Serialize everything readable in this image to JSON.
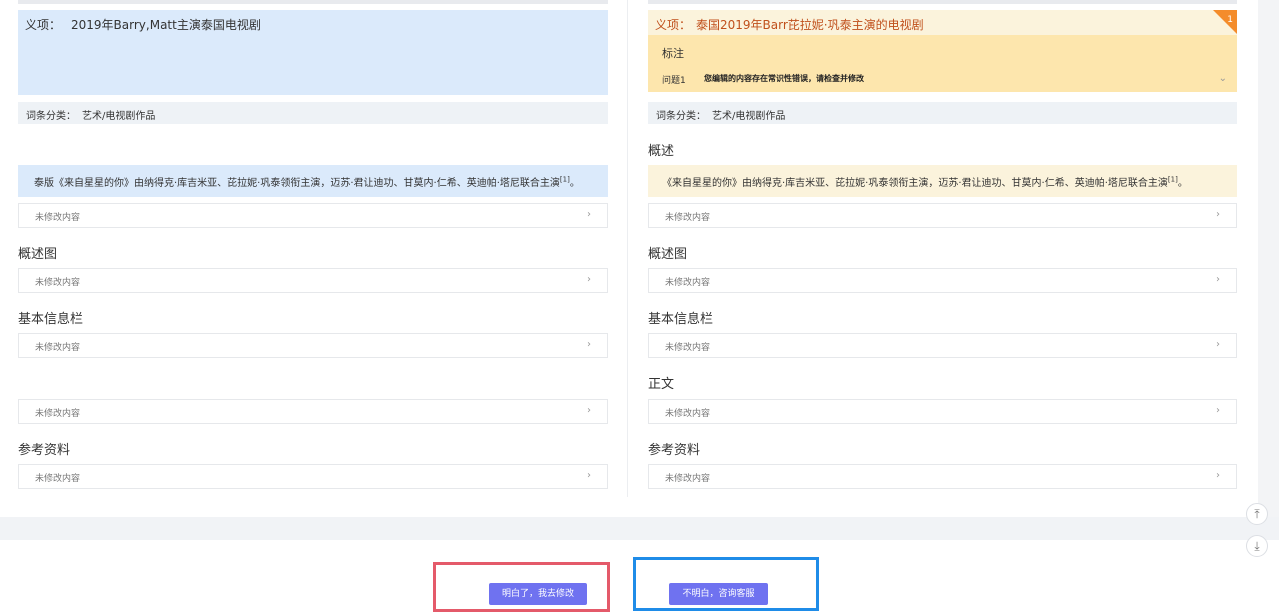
{
  "left": {
    "yixiang_label": "义项：",
    "yixiang_value": "2019年Barry,Matt主演泰国电视剧",
    "category_label": "词条分类：",
    "category_value": "艺术/电视剧作品",
    "summary_text": "泰版《来自星星的你》由纳得克·库吉米亚、芘拉妮·巩泰领衔主演，迈苏·君让迪功、甘莫内·仁希、英迪帕·塔尼联合主演",
    "summary_ref": "[1]",
    "summary_end": "。",
    "rows": [
      {
        "label": "未修改内容"
      },
      {
        "label": "未修改内容"
      },
      {
        "label": "未修改内容"
      },
      {
        "label": "未修改内容"
      },
      {
        "label": "未修改内容"
      }
    ],
    "headings": {
      "overview_image": "概述图",
      "basic_info": "基本信息栏",
      "references": "参考资料"
    }
  },
  "right": {
    "yixiang_label": "义项：",
    "yixiang_value": "泰国2019年Barr芘拉妮·巩泰主演的电视剧",
    "badge_count": "1",
    "annotation_title": "标注",
    "annotation_question": "问题1",
    "annotation_text": "您编辑的内容存在常识性错误，请检查并修改",
    "category_label": "词条分类：",
    "category_value": "艺术/电视剧作品",
    "summary_text": "《来自星星的你》由纳得克·库吉米亚、芘拉妮·巩泰领衔主演，迈苏·君让迪功、甘莫内·仁希、英迪帕·塔尼联合主演",
    "summary_ref": "[1]",
    "summary_end": "。",
    "rows": [
      {
        "label": "未修改内容"
      },
      {
        "label": "未修改内容"
      },
      {
        "label": "未修改内容"
      },
      {
        "label": "未修改内容"
      },
      {
        "label": "未修改内容"
      }
    ],
    "headings": {
      "overview": "概述",
      "overview_image": "概述图",
      "basic_info": "基本信息栏",
      "body": "正文",
      "references": "参考资料"
    }
  },
  "icons": {
    "chevron": "›",
    "expand": "⌄",
    "back_to_top": "⤒",
    "go_to_bottom": "⤓"
  },
  "actions": {
    "understood_label": "明白了，我去修改",
    "consult_label": "不明白，咨询客服"
  },
  "colors": {
    "accent_button": "#6f72f0",
    "frame_red": "#e45a6a",
    "frame_blue": "#1f8ce8",
    "badge_orange": "#f48c2b",
    "left_highlight": "#dbeafb",
    "right_highlight": "#fbf3dc",
    "annotation_bg": "#fde6ad"
  }
}
